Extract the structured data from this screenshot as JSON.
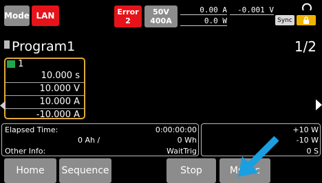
{
  "status": {
    "mode": "Mode",
    "lan": "LAN",
    "error_label": "Error",
    "error_count": "2",
    "voltage_range": "50V",
    "current_range": "400A",
    "current_reading": "0.00 A",
    "current_reading_2": "-0.001 V",
    "power_reading": "0.0 W",
    "sync": "Sync"
  },
  "program": {
    "title": "Program1",
    "page": "1/2",
    "step": {
      "number": "1",
      "time": "10.000 s",
      "voltage": "10.000 V",
      "current": "10.000 A",
      "current_2": "-10.000 A"
    }
  },
  "info": {
    "elapsed_label": "Elapsed Time:",
    "ah_value": "0 Ah /",
    "other_label": "Other Info:",
    "elapsed_value": "0:00:00:00",
    "wh_value": "0 Wh",
    "trigger_state": "WaitTrig",
    "right_1": "+10 W",
    "right_2": "-10 W",
    "right_3": "0 S"
  },
  "buttons": {
    "home": "Home",
    "sequence": "Sequence",
    "stop": "Stop",
    "msync": "Msync"
  },
  "colors": {
    "accent_red": "#e6141a",
    "highlight_orange": "#e3a93a",
    "button_gray": "#8c8c8c",
    "arrow_blue": "#1a9fe0"
  }
}
